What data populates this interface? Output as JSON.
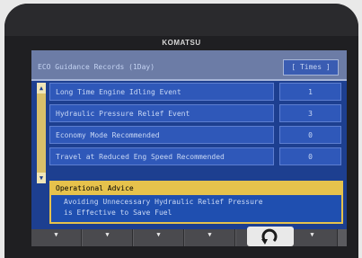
{
  "brand": "KOMATSU",
  "header": {
    "title": "ECO Guidance Records  (1Day)",
    "unit": "[ Times ]"
  },
  "records": [
    {
      "label": "Long Time Engine Idling Event",
      "value": "1"
    },
    {
      "label": "Hydraulic Pressure Relief Event",
      "value": "3"
    },
    {
      "label": "Economy Mode Recommended",
      "value": "0"
    },
    {
      "label": "Travel at Reduced Eng Speed Recommended",
      "value": "0"
    }
  ],
  "advice": {
    "heading": "Operational Advice",
    "line1": "Avoiding Unnecessary Hydraulic Relief Pressure",
    "line2": "is Effective to Save Fuel"
  },
  "function_keys": [
    "▼",
    "▼",
    "▼",
    "▼",
    "▼",
    "▼"
  ],
  "icons": {
    "scroll_up": "up-triangle",
    "scroll_down": "down-triangle",
    "back": "return-arrow"
  },
  "colors": {
    "screen_bg": "#1d3f90",
    "header_bg": "#6c7ca6",
    "accent_yellow": "#e6c24c",
    "bezel": "#1f1f22"
  }
}
